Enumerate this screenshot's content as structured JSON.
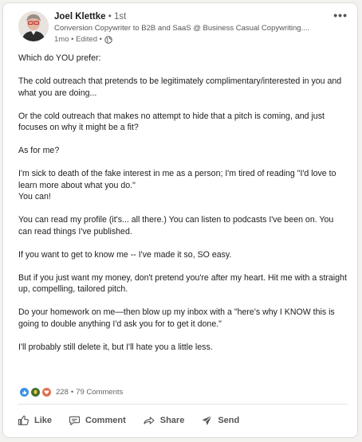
{
  "post": {
    "author": {
      "name": "Joel Klettke",
      "degree": " • 1st",
      "headline": "Conversion Copywriter to B2B and SaaS @ Business Casual Copywriting....",
      "meta": "1mo • Edited •",
      "avatar_icon": "avatar-photo"
    },
    "more_icon": "•••",
    "paragraphs": [
      "Which do YOU prefer:",
      "The cold outreach that pretends to be legitimately complimentary/interested in you and what you are doing...",
      "Or the cold outreach that makes no attempt to hide that a pitch is coming, and just focuses on why it might be a fit?",
      "As for me?",
      "I'm sick to death of the fake interest in me as a person; I'm tired of reading \"I'd love to learn more about what you do.\"",
      "You can read my profile (it's... all there.) You can listen to podcasts I've been on. You can read things I've published.",
      "If you want to get to know me -- I've made it so, SO easy.",
      "But if you just want my money, don't pretend you're after my heart. Hit me with a straight up, compelling, tailored pitch.",
      "Do your homework on me—then blow up my inbox with a \"here's why I KNOW this is going to double anything I'd ask you for to get it done.\"",
      "I'll probably still delete it, but I'll hate you a little less."
    ],
    "paragraph_5_extra_line": "You can!",
    "reactions": {
      "types": [
        "like-reaction-icon",
        "celebrate-reaction-icon",
        "love-reaction-icon"
      ],
      "count": "228",
      "separator": "•",
      "comments": "79 Comments"
    },
    "actions": {
      "like": "Like",
      "comment": "Comment",
      "share": "Share",
      "send": "Send"
    },
    "colors": {
      "like": "#378fe9",
      "celebrate": "#44712e",
      "love": "#df704d",
      "text": "#1d1d1d",
      "muted": "#666666"
    }
  }
}
